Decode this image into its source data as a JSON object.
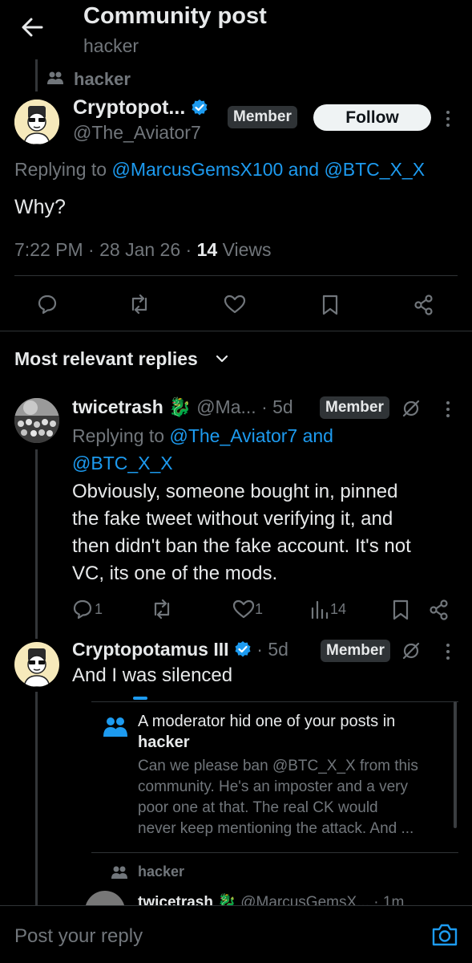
{
  "header": {
    "title": "Community post",
    "subtitle": "hacker"
  },
  "main_post": {
    "community": "hacker",
    "display_name": "Cryptopot...",
    "handle": "@The_Aviator7",
    "badge": "Member",
    "follow_label": "Follow",
    "replying_prefix": "Replying to",
    "replying_user1": "@MarcusGemsX100",
    "replying_and": "and",
    "replying_user2": "@BTC_X_X",
    "text": "Why?",
    "time": "7:22 PM",
    "sep1": "·",
    "date": "28 Jan 26",
    "sep2": "·",
    "views_count": "14",
    "views_label": "Views"
  },
  "replies_header": "Most relevant replies",
  "reply1": {
    "display_name": "twicetrash",
    "handle": "@Ma...",
    "sep": "·",
    "time": "5d",
    "badge": "Member",
    "replying_prefix": "Replying to",
    "replying_user1": "@The_Aviator7",
    "replying_and": "and",
    "replying_user2": "@BTC_X_X",
    "line1": "Obviously, someone bought in, pinned",
    "line2": "the fake tweet without verifying it, and",
    "line3": "then didn't ban the fake account. It's not",
    "line4": "VC, its one of the mods.",
    "replies_count": "1",
    "likes_count": "1",
    "views_count": "14"
  },
  "reply2": {
    "display_name": "Cryptopotamus III",
    "sep": "·",
    "time": "5d",
    "badge": "Member",
    "text": "And I was silenced"
  },
  "moderation_card": {
    "title": "A moderator hid one of your posts in",
    "community": "hacker",
    "line1": "Can we please ban @BTC_X_X from this",
    "line2": "community. He's an imposter and a very",
    "line3": "poor one at that. The real CK would",
    "line4": "never keep mentioning the attack. And ..."
  },
  "nested": {
    "community": "hacker",
    "display_name": "twicetrash",
    "handle": "@MarcusGemsX...",
    "time": "· 1m"
  },
  "reply_bar": {
    "placeholder": "Post your reply"
  },
  "colors": {
    "background": "#000000",
    "accent": "#1d9bf0",
    "muted": "#71767b",
    "text": "#e7e9ea"
  }
}
